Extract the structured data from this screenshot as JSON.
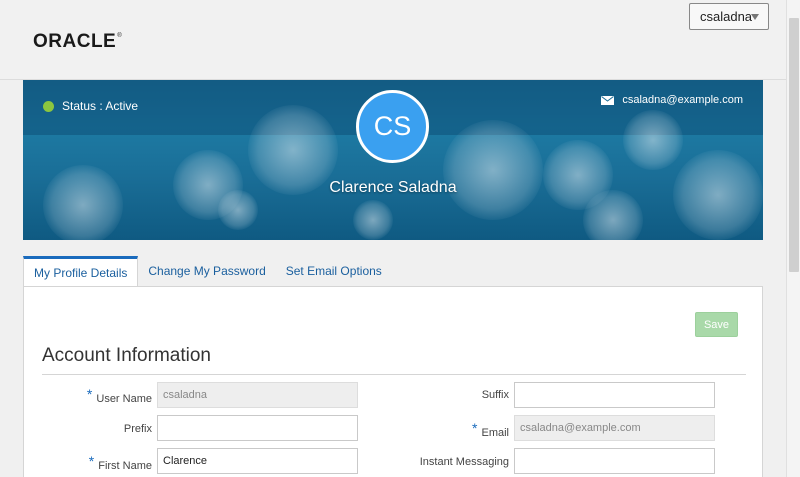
{
  "header": {
    "logo_text": "ORACLE",
    "logo_mark": "®",
    "user_menu_label": "csaladna"
  },
  "banner": {
    "status_text": "Status : Active",
    "email": "csaladna@example.com",
    "avatar_initials": "CS",
    "full_name": "Clarence Saladna",
    "status_color": "#8cc63f",
    "avatar_color": "#3aa0f0"
  },
  "tabs": [
    {
      "label": "My Profile Details",
      "active": true
    },
    {
      "label": "Change My Password",
      "active": false
    },
    {
      "label": "Set Email Options",
      "active": false
    }
  ],
  "form": {
    "save_label": "Save",
    "section_title": "Account Information",
    "required_marker": "*",
    "fields": {
      "user_name": {
        "label": "User Name",
        "value": "csaladna"
      },
      "prefix": {
        "label": "Prefix",
        "value": ""
      },
      "first_name": {
        "label": "First Name",
        "value": "Clarence"
      },
      "suffix": {
        "label": "Suffix",
        "value": ""
      },
      "email": {
        "label": "Email",
        "value": "csaladna@example.com"
      },
      "instant_messaging": {
        "label": "Instant Messaging",
        "value": ""
      }
    }
  },
  "colors": {
    "accent": "#1a6bbd",
    "save_button": "#a9d9a9"
  }
}
